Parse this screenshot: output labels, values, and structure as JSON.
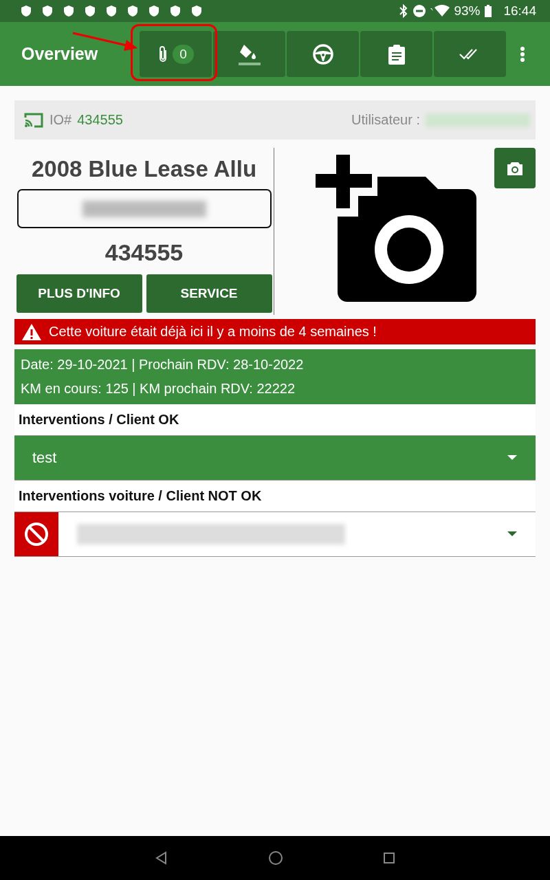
{
  "status_bar": {
    "battery": "93%",
    "time": "16:44"
  },
  "app_bar": {
    "title": "Overview"
  },
  "toolbar": [
    {
      "kind": "attachments",
      "badge": "0"
    },
    {
      "kind": "paint"
    },
    {
      "kind": "steering"
    },
    {
      "kind": "clipboard"
    },
    {
      "kind": "done-all"
    }
  ],
  "vehicle_header": {
    "io_label": "IO#",
    "io_number": "434555",
    "user_label": "Utilisateur :"
  },
  "vehicle": {
    "model": "2008 Blue Lease Allu",
    "number": "434555"
  },
  "buttons": [
    "PLUS D'INFO",
    "SERVICE"
  ],
  "alert": "Cette voiture était déjà ici il y a moins de 4 semaines !",
  "history": [
    "Date: 29-10-2021 | Prochain RDV: 28-10-2022",
    "KM en cours: 125 | KM prochain RDV: 22222"
  ],
  "sections": [
    {
      "label": "Interventions / Client OK",
      "kind": "ok",
      "value": "test"
    },
    {
      "label": "Interventions voiture / Client NOT OK",
      "kind": "not-ok"
    }
  ]
}
